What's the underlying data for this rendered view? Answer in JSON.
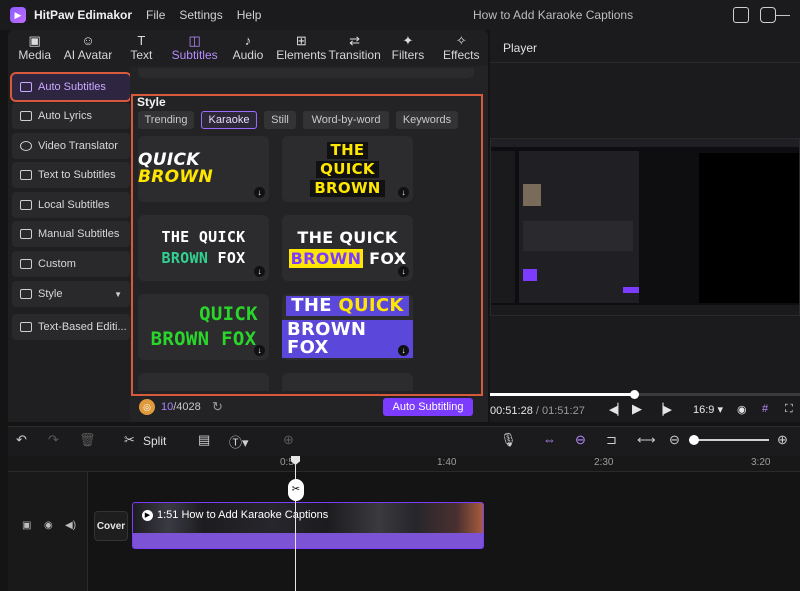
{
  "app": {
    "name": "HitPaw Edimakor",
    "menus": [
      "File",
      "Settings",
      "Help"
    ],
    "project_title": "How to Add Karaoke Captions"
  },
  "tool_tabs": [
    {
      "label": "Media",
      "icon": "image-icon"
    },
    {
      "label": "AI Avatar",
      "icon": "avatar-icon"
    },
    {
      "label": "Text",
      "icon": "text-icon"
    },
    {
      "label": "Subtitles",
      "icon": "subtitles-icon",
      "active": true
    },
    {
      "label": "Audio",
      "icon": "music-note-icon"
    },
    {
      "label": "Elements",
      "icon": "elements-icon"
    },
    {
      "label": "Transition",
      "icon": "transition-icon"
    },
    {
      "label": "Filters",
      "icon": "filters-icon"
    },
    {
      "label": "Effects",
      "icon": "effects-icon"
    }
  ],
  "sidebar": {
    "items": [
      {
        "label": "Auto Subtitles",
        "active": true
      },
      {
        "label": "Auto Lyrics"
      },
      {
        "label": "Video Translator"
      },
      {
        "label": "Text to Subtitles"
      },
      {
        "label": "Local Subtitles"
      },
      {
        "label": "Manual Subtitles"
      },
      {
        "label": "Custom"
      },
      {
        "label": "Style",
        "dropdown": true
      },
      {
        "label": "Text-Based Editi..."
      }
    ]
  },
  "style_panel": {
    "title": "Style",
    "chips": [
      "Trending",
      "Karaoke",
      "Still",
      "Word-by-word",
      "Keywords"
    ],
    "active_chip": "Karaoke",
    "cards": {
      "c1": {
        "a": "QUICK ",
        "b": "BROWN"
      },
      "c2": {
        "l1": "THE",
        "l2": "QUICK",
        "l3": "BROWN"
      },
      "c3": {
        "l1": "THE QUICK",
        "l2a": "BROWN",
        "l2b": " FOX"
      },
      "c4": {
        "l1": "THE QUICK",
        "l2a": "BROWN",
        "l2b": " FOX"
      },
      "c5": {
        "l1": "QUICK",
        "l2": "BROWN FOX"
      },
      "c6": {
        "l1a": "THE ",
        "l1b": "QUICK",
        "l2": "BROWN FOX"
      }
    },
    "credits_current": "10",
    "credits_total": "/4028",
    "auto_button": "Auto Subtitling"
  },
  "player": {
    "title": "Player",
    "current_time": "00:51:28",
    "total_time": " / 01:51:27",
    "aspect": "16:9",
    "progress": 0.46
  },
  "timeline": {
    "split_label": "Split",
    "ruler": [
      "0:5",
      "1:40",
      "2:30",
      "3:20"
    ],
    "cover_label": "Cover",
    "clip_label": "1:51 How to Add Karaoke Captions"
  },
  "colors": {
    "accent": "#7c3cff",
    "highlight_outline": "#d85a3c",
    "karaoke_yellow": "#ffe600"
  }
}
